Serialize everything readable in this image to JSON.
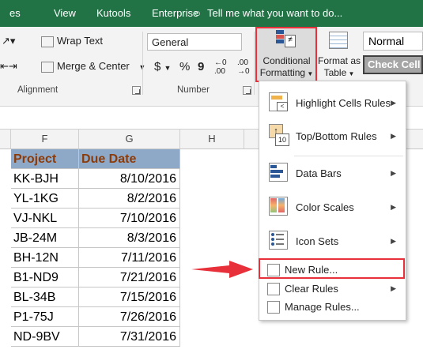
{
  "tabs": [
    "View",
    "Kutools",
    "Enterprise"
  ],
  "tell_me": "Tell me what you want to do...",
  "alignment": {
    "wrap_text": "Wrap Text",
    "merge_center": "Merge & Center",
    "label": "Alignment"
  },
  "number": {
    "format_value": "General",
    "currency": "$",
    "percent": "%",
    "comma": "9",
    "inc_decimal": "+.0 .00",
    "dec_decimal": ".00 →.0",
    "label": "Number"
  },
  "styles": {
    "conditional_formatting_line1": "Conditional",
    "conditional_formatting_line2": "Formatting",
    "format_as_table_line1": "Format as",
    "format_as_table_line2": "Table",
    "normal": "Normal",
    "check_cell": "Check Cell"
  },
  "columns": [
    "F",
    "G",
    "H"
  ],
  "table": {
    "headers": [
      "Project",
      "Due Date"
    ],
    "rows": [
      [
        "KK-BJH",
        "8/10/2016"
      ],
      [
        "YL-1KG",
        "8/2/2016"
      ],
      [
        "VJ-NKL",
        "7/10/2016"
      ],
      [
        "JB-24M",
        "8/3/2016"
      ],
      [
        "BH-12N",
        "7/11/2016"
      ],
      [
        "B1-ND9",
        "7/21/2016"
      ],
      [
        "BL-34B",
        "7/15/2016"
      ],
      [
        "P1-75J",
        "7/26/2016"
      ],
      [
        "ND-9BV",
        "7/31/2016"
      ]
    ]
  },
  "menu": {
    "items": [
      {
        "label": "Highlight Cells Rules",
        "icon": "highlight-cells-icon"
      },
      {
        "label": "Top/Bottom Rules",
        "icon": "top-bottom-icon"
      },
      {
        "label": "Data Bars",
        "icon": "data-bars-icon"
      },
      {
        "label": "Color Scales",
        "icon": "color-scales-icon"
      },
      {
        "label": "Icon Sets",
        "icon": "icon-sets-icon"
      }
    ],
    "new_rule": "New Rule...",
    "clear_rules": "Clear Rules",
    "manage_rules": "Manage Rules..."
  },
  "colors": {
    "ribbon_green": "#217346",
    "header_fill": "#8ea9c8",
    "header_text": "#8b3b0a",
    "highlight_red": "#e8303a",
    "arrow_red": "#e8303a"
  }
}
